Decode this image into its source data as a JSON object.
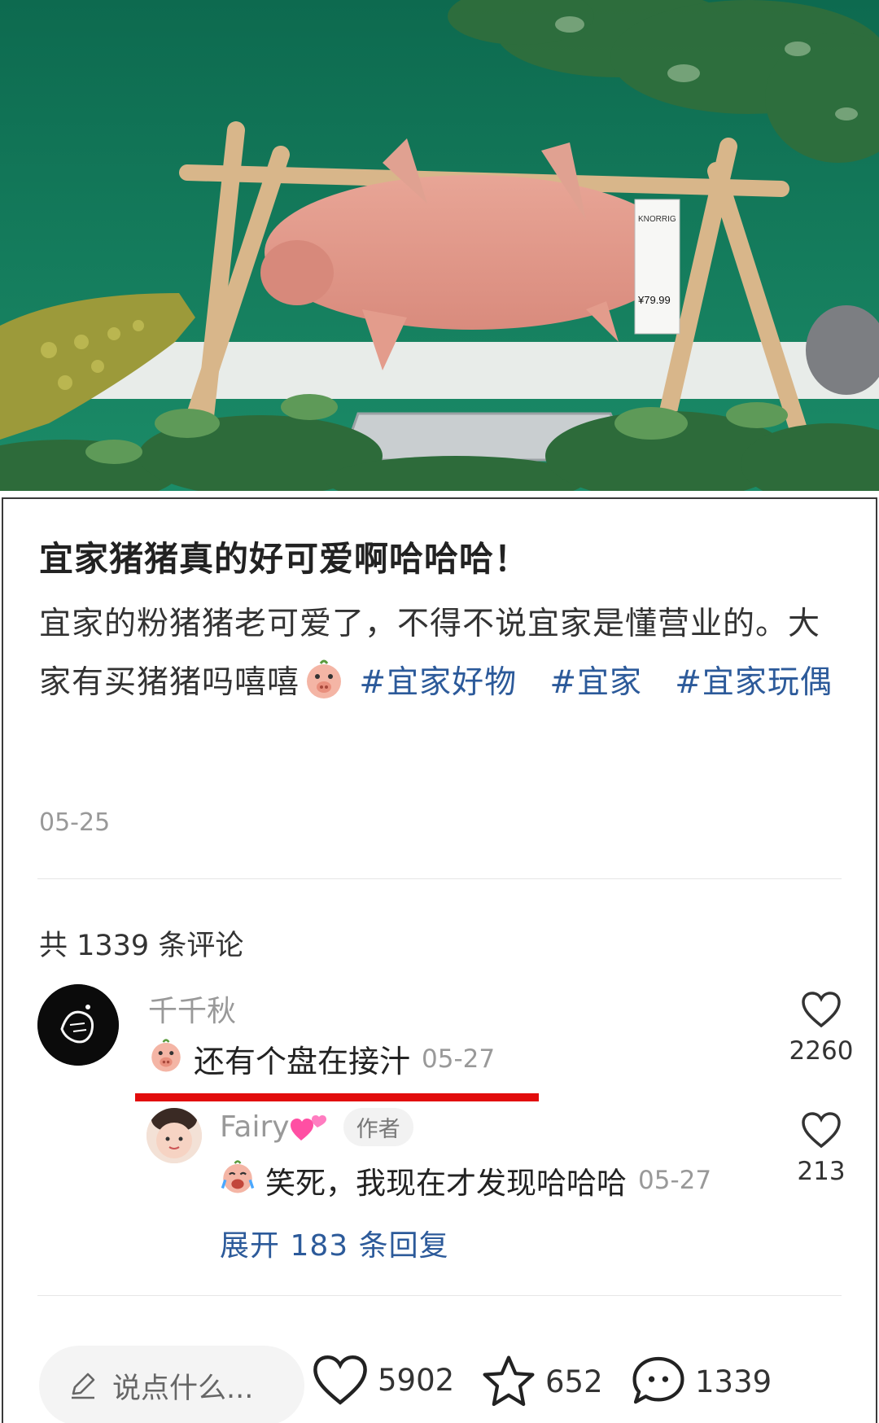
{
  "post": {
    "title": "宜家猪猪真的好可爱啊哈哈哈！",
    "body_1": "宜家的粉猪猪老可爱了，不得不说宜家是懂营业的。大家有买猪猪吗嘻嘻",
    "tags": [
      "#宜家好物",
      "#宜家",
      "#宜家玩偶"
    ],
    "date": "05-25",
    "price_tag": {
      "brand": "KNORRIG",
      "price": "¥79.99"
    }
  },
  "comments": {
    "count_label": "共 1339 条评论",
    "items": [
      {
        "user": "千千秋",
        "text": "还有个盘在接汁",
        "date": "05-27",
        "likes": "2260"
      }
    ],
    "reply": {
      "user": "Fairy",
      "badge": "作者",
      "text": "笑死，我现在才发现哈哈哈",
      "date": "05-27",
      "likes": "213"
    },
    "expand_label": "展开 183 条回复"
  },
  "bottom_bar": {
    "input_placeholder": "说点什么...",
    "likes": "5902",
    "favorites": "652",
    "comments": "1339"
  },
  "colors": {
    "tag": "#2c5a9a",
    "annotation_red": "#e20c0c",
    "muted_text": "#999999"
  }
}
